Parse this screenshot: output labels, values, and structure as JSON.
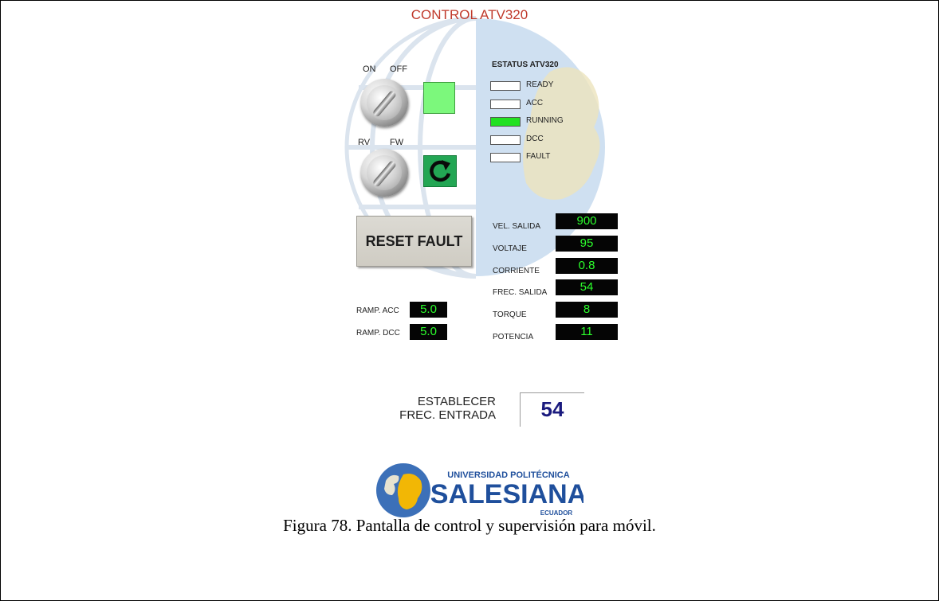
{
  "screen": {
    "title": "CONTROL ATV320"
  },
  "switches": {
    "power": {
      "left_label": "ON",
      "right_label": "OFF"
    },
    "direction": {
      "left_label": "RV",
      "right_label": "FW"
    }
  },
  "status": {
    "title": "ESTATUS ATV320",
    "items": [
      {
        "label": "READY",
        "active": false
      },
      {
        "label": "ACC",
        "active": false
      },
      {
        "label": "RUNNING",
        "active": true
      },
      {
        "label": "DCC",
        "active": false
      },
      {
        "label": "FAULT",
        "active": false
      }
    ]
  },
  "reset_button": {
    "label": "RESET FAULT"
  },
  "measurements": [
    {
      "label": "VEL. SALIDA",
      "value": "900"
    },
    {
      "label": "VOLTAJE",
      "value": "95"
    },
    {
      "label": "CORRIENTE",
      "value": "0.8"
    },
    {
      "label": "FREC. SALIDA",
      "value": "54"
    },
    {
      "label": "TORQUE",
      "value": "8"
    },
    {
      "label": "POTENCIA",
      "value": "11"
    }
  ],
  "ramps": [
    {
      "label": "RAMP. ACC",
      "value": "5.0"
    },
    {
      "label": "RAMP. DCC",
      "value": "5.0"
    }
  ],
  "setpoint": {
    "label_line1": "ESTABLECER",
    "label_line2": "FREC. ENTRADA",
    "value": "54"
  },
  "logo": {
    "line1": "UNIVERSIDAD POLITÉCNICA",
    "line2": "SALESIANA",
    "line3": "ECUADOR"
  },
  "caption": "Figura 78. Pantalla de control y supervisión para móvil.",
  "colors": {
    "title": "#c0392b",
    "lcd_text": "#2cff2c",
    "status_on": "#22e122",
    "setpoint_text": "#1a1a7e",
    "logo_blue": "#1f4f9c",
    "logo_gold": "#f2b705"
  }
}
